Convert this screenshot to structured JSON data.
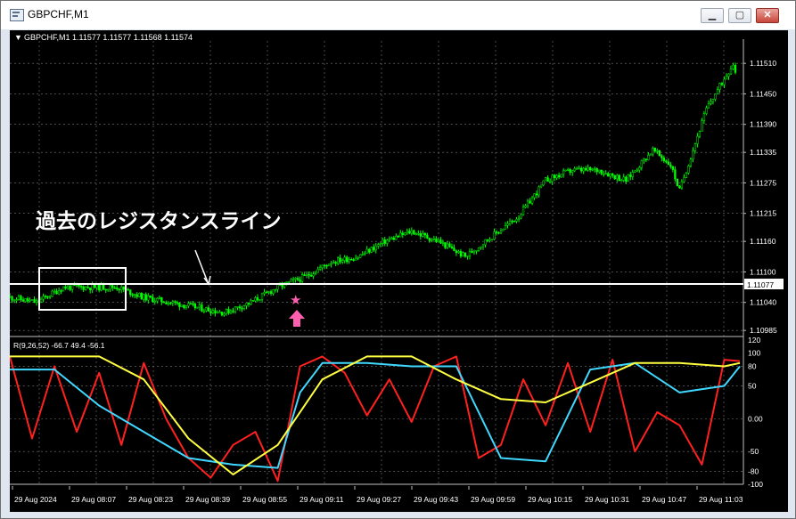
{
  "window": {
    "title": "GBPCHF,M1",
    "minimize_symbol": "▁",
    "maximize_symbol": "▢",
    "close_symbol": "✕"
  },
  "main_chart": {
    "header": "GBPCHF,M1  1.11577 1.11577 1.11568 1.11574",
    "price_labels": [
      "1.11510",
      "1.11450",
      "1.11390",
      "1.11335",
      "1.11275",
      "1.11215",
      "1.11160",
      "1.11100",
      "1.11040",
      "1.10985"
    ],
    "current_price_label": "1.11077",
    "annotation_text": "過去のレジスタンスライン",
    "colors": {
      "background": "#000000",
      "grid": "#808080",
      "candles": "#00ff00",
      "resistance_line": "#ffffff",
      "signal": "#ff5faf"
    }
  },
  "indicator_panel": {
    "header": "R(9,26,52) -66.7 49.4 -56.1",
    "level_labels": [
      "120",
      "100",
      "80",
      "50",
      "0.00",
      "-50",
      "-80",
      "-100"
    ],
    "colors": {
      "fast": "#ff2020",
      "middle": "#40d8ff",
      "slow": "#ffff40"
    }
  },
  "time_axis": {
    "labels": [
      "29 Aug 2024",
      "29 Aug 08:07",
      "29 Aug 08:23",
      "29 Aug 08:39",
      "29 Aug 08:55",
      "29 Aug 09:11",
      "29 Aug 09:27",
      "29 Aug 09:43",
      "29 Aug 09:59",
      "29 Aug 10:15",
      "29 Aug 10:31",
      "29 Aug 10:47",
      "29 Aug 11:03"
    ]
  },
  "chart_data": [
    {
      "type": "candlestick",
      "title": "GBPCHF,M1",
      "ylim": [
        1.1098,
        1.1154
      ],
      "x_labels": [
        "29 Aug 2024",
        "29 Aug 08:07",
        "29 Aug 08:23",
        "29 Aug 08:39",
        "29 Aug 08:55",
        "29 Aug 09:11",
        "29 Aug 09:27",
        "29 Aug 09:43",
        "29 Aug 09:59",
        "29 Aug 10:15",
        "29 Aug 10:31",
        "29 Aug 10:47",
        "29 Aug 11:03"
      ],
      "close_path": [
        [
          0,
          1.1105
        ],
        [
          12,
          1.1104
        ],
        [
          24,
          1.1107
        ],
        [
          36,
          1.1107
        ],
        [
          48,
          1.1107
        ],
        [
          60,
          1.1105
        ],
        [
          72,
          1.1104
        ],
        [
          84,
          1.1103
        ],
        [
          96,
          1.1102
        ],
        [
          108,
          1.1104
        ],
        [
          120,
          1.1107
        ],
        [
          132,
          1.1109
        ],
        [
          144,
          1.1112
        ],
        [
          156,
          1.1113
        ],
        [
          168,
          1.1116
        ],
        [
          180,
          1.1118
        ],
        [
          192,
          1.1116
        ],
        [
          204,
          1.1113
        ],
        [
          216,
          1.1117
        ],
        [
          228,
          1.1121
        ],
        [
          240,
          1.1128
        ],
        [
          252,
          1.113
        ],
        [
          264,
          1.113
        ],
        [
          276,
          1.1128
        ],
        [
          288,
          1.1134
        ],
        [
          296,
          1.1131
        ],
        [
          300,
          1.1126
        ],
        [
          312,
          1.1142
        ],
        [
          320,
          1.1148
        ],
        [
          324,
          1.1151
        ],
        [
          327,
          1.1146
        ]
      ],
      "resistance_level": 1.11077,
      "last_price": 1.11574
    },
    {
      "type": "line",
      "title": "R(9,26,52)",
      "ylim": [
        -100,
        120
      ],
      "levels": [
        80,
        50,
        0,
        -50,
        -80
      ],
      "series": [
        {
          "color": "#ff2020",
          "x": [
            0,
            10,
            20,
            30,
            40,
            50,
            60,
            70,
            80,
            90,
            100,
            110,
            120,
            130,
            140,
            150,
            160,
            170,
            180,
            190,
            200,
            210,
            220,
            230,
            240,
            250,
            260,
            270,
            280,
            290,
            300,
            310,
            320,
            327
          ],
          "values": [
            95,
            -30,
            80,
            -20,
            70,
            -40,
            85,
            0,
            -60,
            -90,
            -40,
            -20,
            -95,
            80,
            95,
            70,
            5,
            60,
            -5,
            80,
            95,
            -60,
            -40,
            60,
            -10,
            85,
            -20,
            90,
            -50,
            10,
            -10,
            -70,
            90,
            88
          ]
        },
        {
          "color": "#40d8ff",
          "x": [
            0,
            20,
            40,
            60,
            80,
            100,
            120,
            130,
            140,
            160,
            180,
            200,
            220,
            240,
            260,
            280,
            300,
            320,
            327
          ],
          "values": [
            75,
            75,
            20,
            -20,
            -60,
            -70,
            -75,
            40,
            85,
            85,
            80,
            80,
            -60,
            -65,
            75,
            85,
            40,
            50,
            80
          ]
        },
        {
          "color": "#ffff40",
          "x": [
            0,
            20,
            40,
            60,
            80,
            100,
            120,
            140,
            160,
            180,
            200,
            220,
            240,
            260,
            280,
            300,
            320,
            327
          ],
          "values": [
            95,
            95,
            95,
            60,
            -30,
            -85,
            -40,
            60,
            95,
            95,
            60,
            30,
            25,
            55,
            85,
            85,
            80,
            85
          ]
        }
      ]
    }
  ]
}
